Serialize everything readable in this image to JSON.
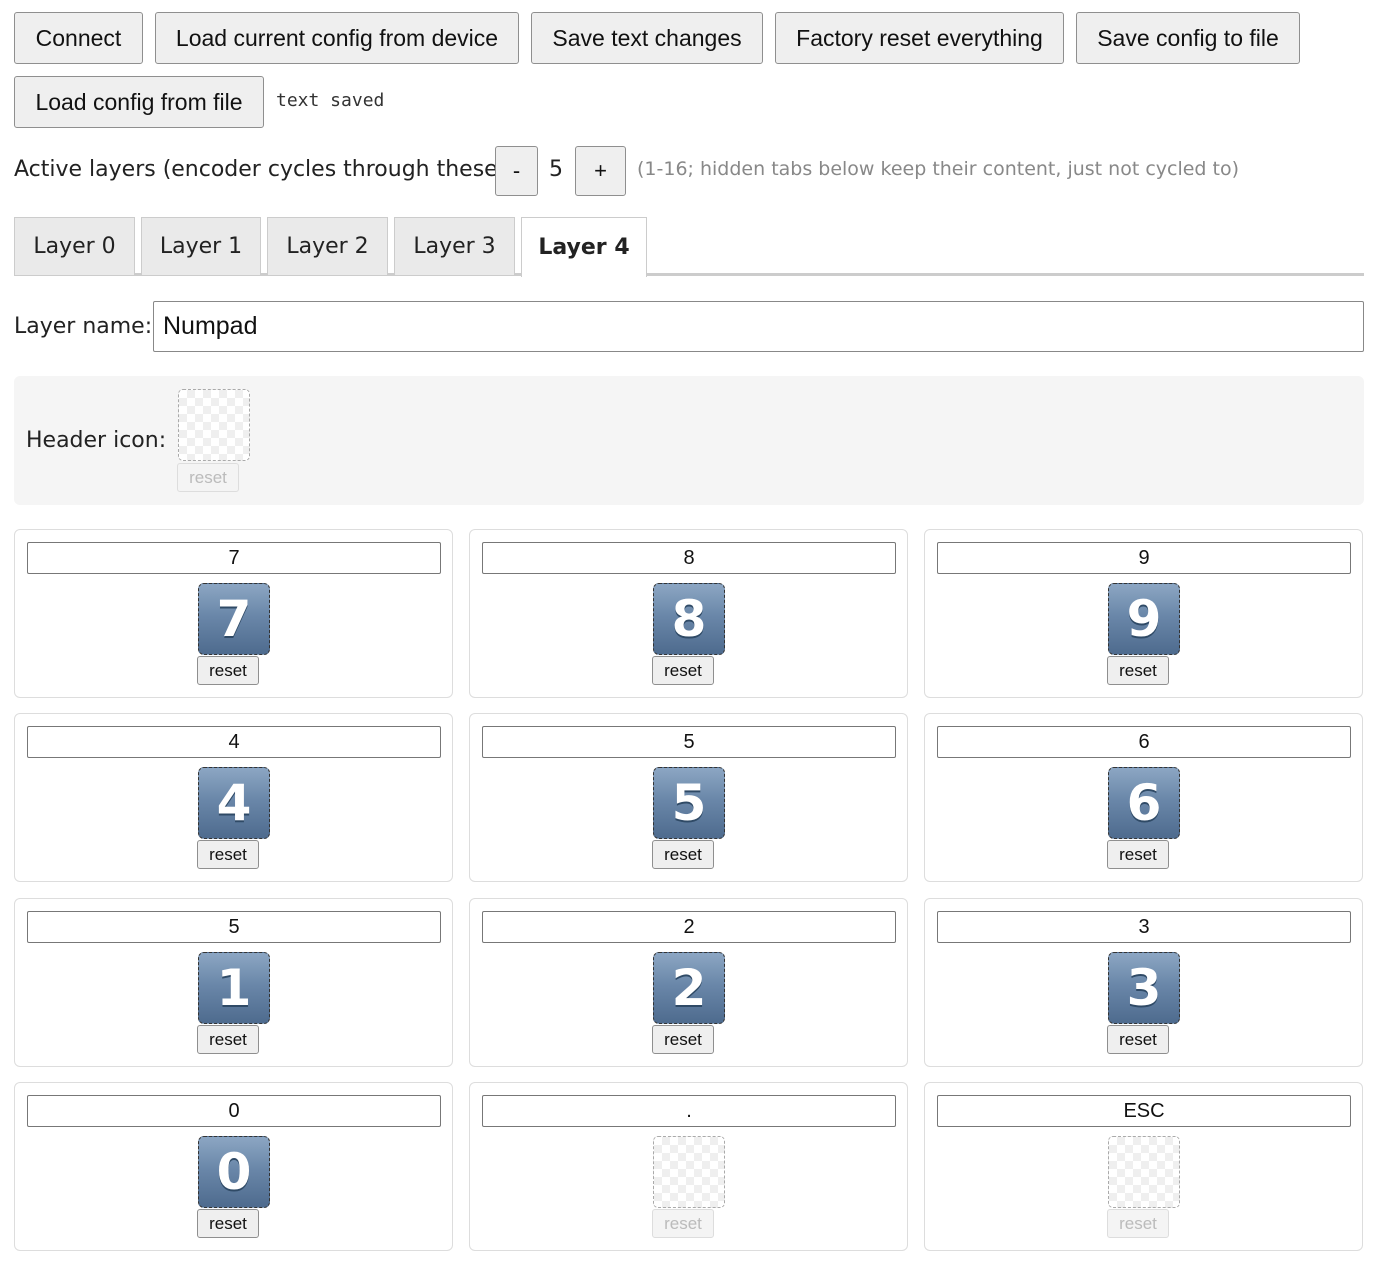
{
  "toolbar": {
    "connect": "Connect",
    "load_device": "Load current config from device",
    "save_text": "Save text changes",
    "factory_reset": "Factory reset everything",
    "save_file": "Save config to file",
    "load_file": "Load config from file",
    "status": "text saved"
  },
  "layers": {
    "label": "Active layers (encoder cycles through these):",
    "minus": "-",
    "value": "5",
    "plus": "+",
    "hint": "(1-16; hidden tabs below keep their content, just not cycled to)"
  },
  "tabs": [
    "Layer 0",
    "Layer 1",
    "Layer 2",
    "Layer 3",
    "Layer 4"
  ],
  "active_tab": "Layer 4",
  "layer_name": {
    "label": "Layer name:",
    "value": "Numpad"
  },
  "header_icon": {
    "label": "Header icon:",
    "reset": "reset"
  },
  "keys": [
    {
      "label": "7",
      "icon": "7",
      "reset": "reset"
    },
    {
      "label": "8",
      "icon": "8",
      "reset": "reset"
    },
    {
      "label": "9",
      "icon": "9",
      "reset": "reset"
    },
    {
      "label": "4",
      "icon": "4",
      "reset": "reset"
    },
    {
      "label": "5",
      "icon": "5",
      "reset": "reset"
    },
    {
      "label": "6",
      "icon": "6",
      "reset": "reset"
    },
    {
      "label": "5",
      "icon": "1",
      "reset": "reset"
    },
    {
      "label": "2",
      "icon": "2",
      "reset": "reset"
    },
    {
      "label": "3",
      "icon": "3",
      "reset": "reset"
    },
    {
      "label": "0",
      "icon": "0",
      "reset": "reset"
    },
    {
      "label": ".",
      "icon": "",
      "reset": "reset"
    },
    {
      "label": "ESC",
      "icon": "",
      "reset": "reset"
    }
  ]
}
